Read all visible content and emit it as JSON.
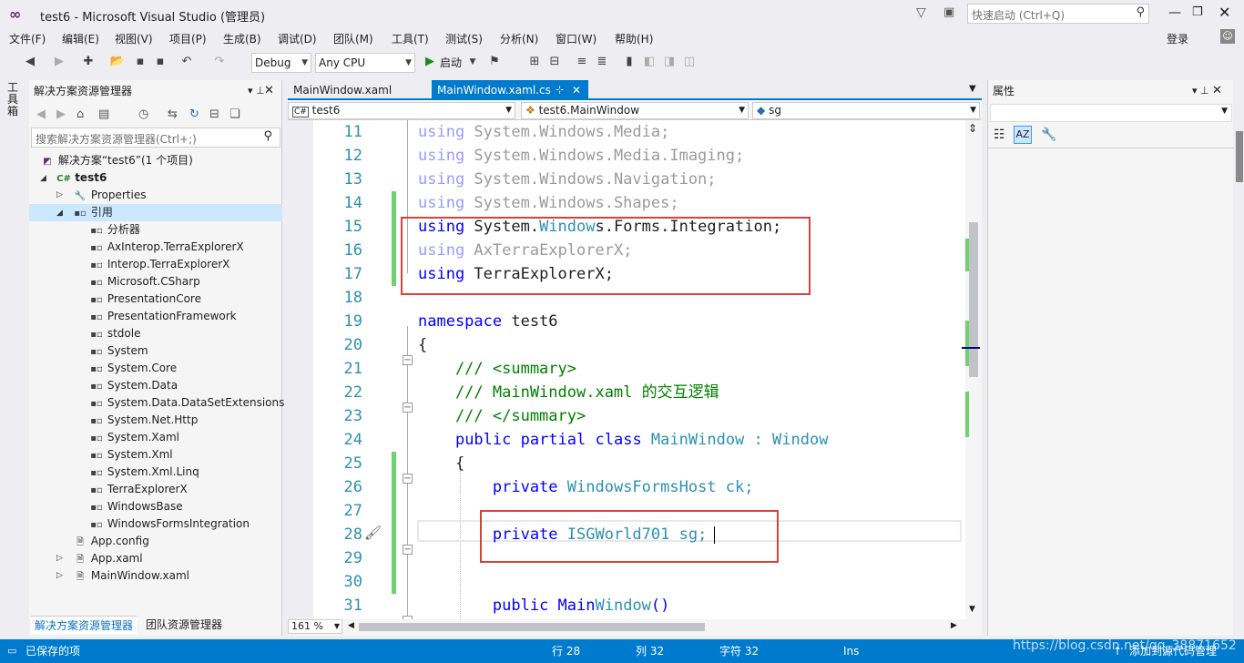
{
  "titlebar": {
    "title": "test6 - Microsoft Visual Studio (管理员)",
    "quick_launch_placeholder": "快速启动 (Ctrl+Q)",
    "login": "登录"
  },
  "menu": [
    "文件(F)",
    "编辑(E)",
    "视图(V)",
    "项目(P)",
    "生成(B)",
    "调试(D)",
    "团队(M)",
    "工具(T)",
    "测试(S)",
    "分析(N)",
    "窗口(W)",
    "帮助(H)"
  ],
  "toolbar": {
    "config": "Debug",
    "platform": "Any CPU",
    "start_label": "启动"
  },
  "left_strip": {
    "toolbox_label": "工具箱"
  },
  "solution_explorer": {
    "title": "解决方案资源管理器",
    "search_placeholder": "搜索解决方案资源管理器(Ctrl+;)",
    "solution": "解决方案“test6”(1 个项目)",
    "project": "test6",
    "properties": "Properties",
    "references": "引用",
    "ref_items": [
      "分析器",
      "AxInterop.TerraExplorerX",
      "Interop.TerraExplorerX",
      "Microsoft.CSharp",
      "PresentationCore",
      "PresentationFramework",
      "stdole",
      "System",
      "System.Core",
      "System.Data",
      "System.Data.DataSetExtensions",
      "System.Net.Http",
      "System.Xaml",
      "System.Xml",
      "System.Xml.Linq",
      "TerraExplorerX",
      "WindowsBase",
      "WindowsFormsIntegration"
    ],
    "files": [
      "App.config",
      "App.xaml",
      "MainWindow.xaml"
    ],
    "bottom_tabs": [
      "解决方案资源管理器",
      "团队资源管理器"
    ]
  },
  "editor": {
    "tabs": [
      "MainWindow.xaml",
      "MainWindow.xaml.cs"
    ],
    "nav": [
      "test6",
      "test6.MainWindow",
      "sg"
    ],
    "zoom": "161 %",
    "lines": [
      {
        "n": "11",
        "t": "using System.Windows.Media;"
      },
      {
        "n": "12",
        "t": "using System.Windows.Media.Imaging;"
      },
      {
        "n": "13",
        "t": "using System.Windows.Navigation;"
      },
      {
        "n": "14",
        "t": "using System.Windows.Shapes;"
      },
      {
        "n": "15",
        "t": "using System.Windows.Forms.Integration;"
      },
      {
        "n": "16",
        "t": "using AxTerraExplorerX;"
      },
      {
        "n": "17",
        "t": "using TerraExplorerX;"
      },
      {
        "n": "18",
        "t": ""
      },
      {
        "n": "19",
        "t": "namespace test6"
      },
      {
        "n": "20",
        "t": "{"
      },
      {
        "n": "21",
        "t": "    /// <summary>"
      },
      {
        "n": "22",
        "t": "    /// MainWindow.xaml 的交互逻辑"
      },
      {
        "n": "23",
        "t": "    /// </summary>"
      },
      {
        "n": "24",
        "t": "    public partial class MainWindow : Window"
      },
      {
        "n": "25",
        "t": "    {"
      },
      {
        "n": "26",
        "t": "        private WindowsFormsHost ck;"
      },
      {
        "n": "27",
        "t": ""
      },
      {
        "n": "28",
        "t": "        private ISGWorld701 sg;"
      },
      {
        "n": "29",
        "t": ""
      },
      {
        "n": "30",
        "t": ""
      },
      {
        "n": "31",
        "t": "        public MainWindow()"
      }
    ]
  },
  "properties": {
    "title": "属性"
  },
  "status": {
    "saved": "已保存的项",
    "row": "行 28",
    "col": "列 32",
    "char": "字符 32",
    "mode": "Ins",
    "source_control": "添加到源代码管理",
    "watermark": "https://blog.csdn.net/qq_38871652"
  }
}
